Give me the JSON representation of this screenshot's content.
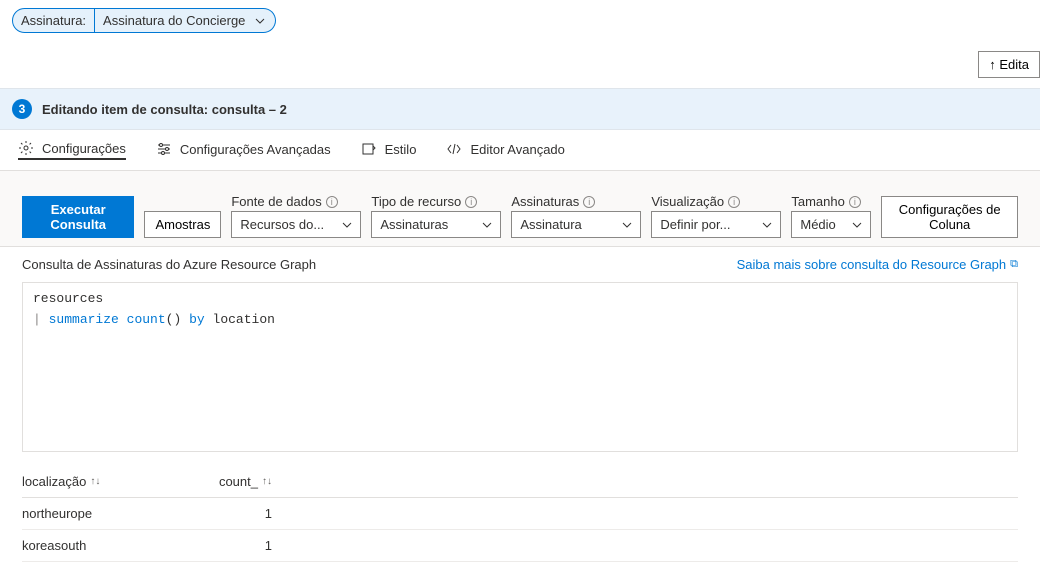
{
  "topbar": {
    "label": "Assinatura:",
    "selected": "Assinatura do Concierge"
  },
  "edit_button": "↑ Edita",
  "step": {
    "number": "3",
    "title": "Editando item de consulta: consulta – 2"
  },
  "tabs": {
    "config": "Configurações",
    "adv_config": "Configurações Avançadas",
    "style": "Estilo",
    "adv_editor": "Editor Avançado"
  },
  "controls": {
    "run": "Executar Consulta",
    "samples": "Amostras",
    "datasource_label": "Fonte de dados",
    "datasource_value": "Recursos do...",
    "resource_type_label": "Tipo de recurso",
    "resource_type_value": "Assinaturas",
    "subscriptions_label": "Assinaturas",
    "subscriptions_value": "Assinatura",
    "visualization_label": "Visualização",
    "visualization_value": "Definir por...",
    "size_label": "Tamanho",
    "size_value": "Médio",
    "column_settings": "Configurações de Coluna"
  },
  "subheader": {
    "left": "Consulta de Assinaturas do Azure Resource Graph",
    "right": "Saiba mais sobre consulta do Resource Graph"
  },
  "query": {
    "line1": "resources",
    "pipe": "|",
    "summarize": "summarize",
    "count_fn": "count",
    "parens": "()",
    "by": "by",
    "location": "location"
  },
  "results": {
    "headers": {
      "location": "localização",
      "count": "count_"
    },
    "rows": [
      {
        "location": "northeurope",
        "count": "1"
      },
      {
        "location": "koreasouth",
        "count": "1"
      }
    ]
  }
}
